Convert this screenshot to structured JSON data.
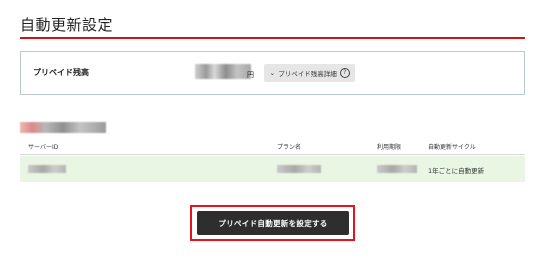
{
  "page": {
    "title": "自動更新設定"
  },
  "balance": {
    "label": "プリペイド残高",
    "currency": "円",
    "detail_button_label": "プリペイド残高詳細",
    "help_icon": "question-circle-icon",
    "chevron_icon": "chevron-down-icon"
  },
  "table": {
    "headers": [
      "サーバーID",
      "プラン名",
      "利用期限",
      "自動更新サイクル"
    ],
    "rows": [
      {
        "cycle": "1年ごとに自動更新"
      }
    ]
  },
  "cta": {
    "label": "プリペイド自動更新を設定する"
  },
  "colors": {
    "accent_red": "#d0121b",
    "panel_border": "#b9cad6",
    "row_highlight": "#eaf6e4",
    "cta_bg": "#2e2e2e"
  }
}
